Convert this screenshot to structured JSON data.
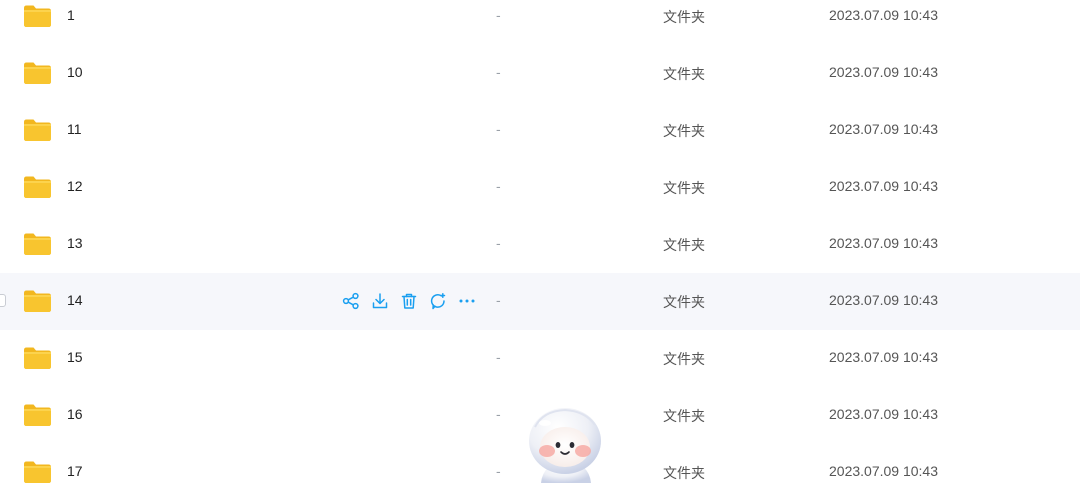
{
  "files": [
    {
      "name": "1",
      "size": "-",
      "type": "文件夹",
      "modified": "2023.07.09 10:43"
    },
    {
      "name": "10",
      "size": "-",
      "type": "文件夹",
      "modified": "2023.07.09 10:43"
    },
    {
      "name": "11",
      "size": "-",
      "type": "文件夹",
      "modified": "2023.07.09 10:43"
    },
    {
      "name": "12",
      "size": "-",
      "type": "文件夹",
      "modified": "2023.07.09 10:43"
    },
    {
      "name": "13",
      "size": "-",
      "type": "文件夹",
      "modified": "2023.07.09 10:43"
    },
    {
      "name": "14",
      "size": "-",
      "type": "文件夹",
      "modified": "2023.07.09 10:43"
    },
    {
      "name": "15",
      "size": "-",
      "type": "文件夹",
      "modified": "2023.07.09 10:43"
    },
    {
      "name": "16",
      "size": "-",
      "type": "文件夹",
      "modified": "2023.07.09 10:43"
    },
    {
      "name": "17",
      "size": "-",
      "type": "文件夹",
      "modified": "2023.07.09 10:43"
    }
  ],
  "row_actions": [
    "share-icon",
    "download-icon",
    "delete-icon",
    "comment-icon",
    "more-icon"
  ],
  "colors": {
    "folder": "#f8c52f",
    "action_accent": "#1a9ff0",
    "hover_row": "#f6f7fb"
  }
}
